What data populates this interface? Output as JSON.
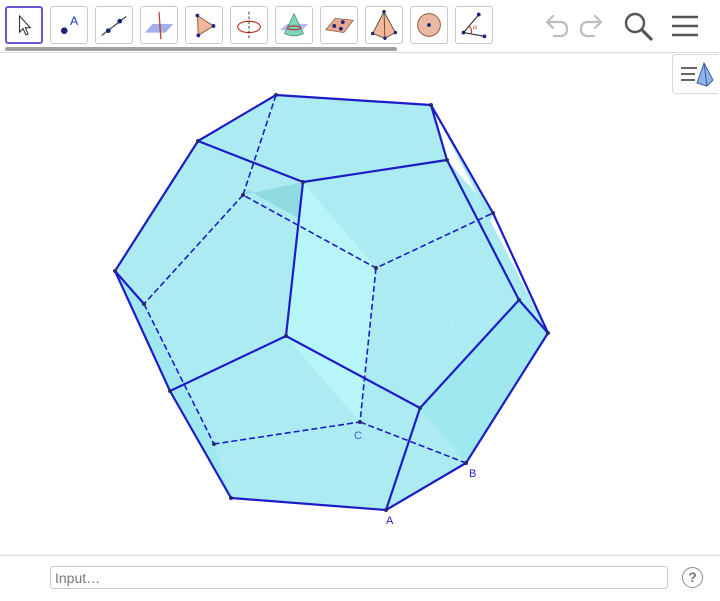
{
  "toolbar": {
    "tools": [
      {
        "icon": "move-icon",
        "active": true
      },
      {
        "icon": "point-icon",
        "label": "A"
      },
      {
        "icon": "line-icon"
      },
      {
        "icon": "perpendicular-line-icon"
      },
      {
        "icon": "polygon-icon"
      },
      {
        "icon": "circle-axis-icon"
      },
      {
        "icon": "intersect-surfaces-icon"
      },
      {
        "icon": "plane-through-points-icon"
      },
      {
        "icon": "pyramid-icon"
      },
      {
        "icon": "sphere-icon"
      },
      {
        "icon": "angle-icon",
        "label": "α"
      }
    ],
    "undo": "undo-icon",
    "redo": "redo-icon",
    "search": "search-icon",
    "menu": "menu-icon"
  },
  "graphics": {
    "fill_color": "#9ee8ee",
    "edge_color": "#1c1cc8",
    "point_labels": {
      "A": "A",
      "B": "B",
      "C": "C"
    }
  },
  "input_bar": {
    "placeholder": "Input…",
    "help": "?"
  },
  "colors": {
    "accent": "#6557d2",
    "polyhedron_fill": "#a8eef3",
    "edge": "#1c1cc8"
  }
}
